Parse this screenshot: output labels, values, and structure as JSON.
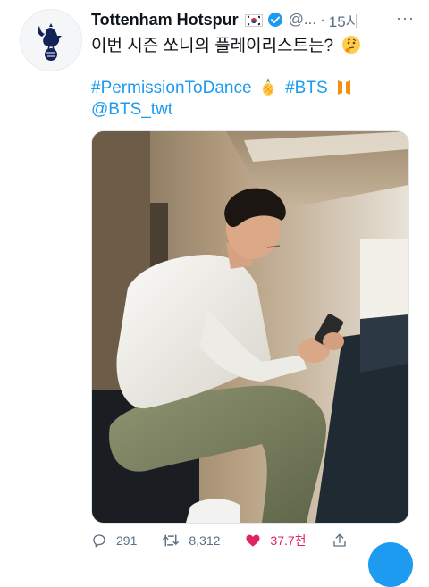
{
  "tweet": {
    "author_name": "Tottenham Hotspur",
    "handle": "@...",
    "separator": "·",
    "time": "15시",
    "more_label": "···",
    "text": "이번 시즌 쏘니의 플레이리스트는?",
    "hashtags": [
      "#PermissionToDance",
      "#BTS"
    ],
    "mention": "@BTS_twt"
  },
  "actions": {
    "replies": "291",
    "retweets": "8,312",
    "likes": "37.7천"
  },
  "colors": {
    "accent": "#1d9bf0",
    "like": "#e0245e",
    "muted": "#5b7083"
  },
  "icons": {
    "avatar": "spurs-cockerel-logo",
    "flag": "south-korea-flag-icon",
    "verified": "verified-badge-icon",
    "emoji_thinking": "thinking-face-emoji",
    "emoji_pineapple": "pineapple-emoji",
    "emoji_bts": "bts-logo-icon"
  }
}
